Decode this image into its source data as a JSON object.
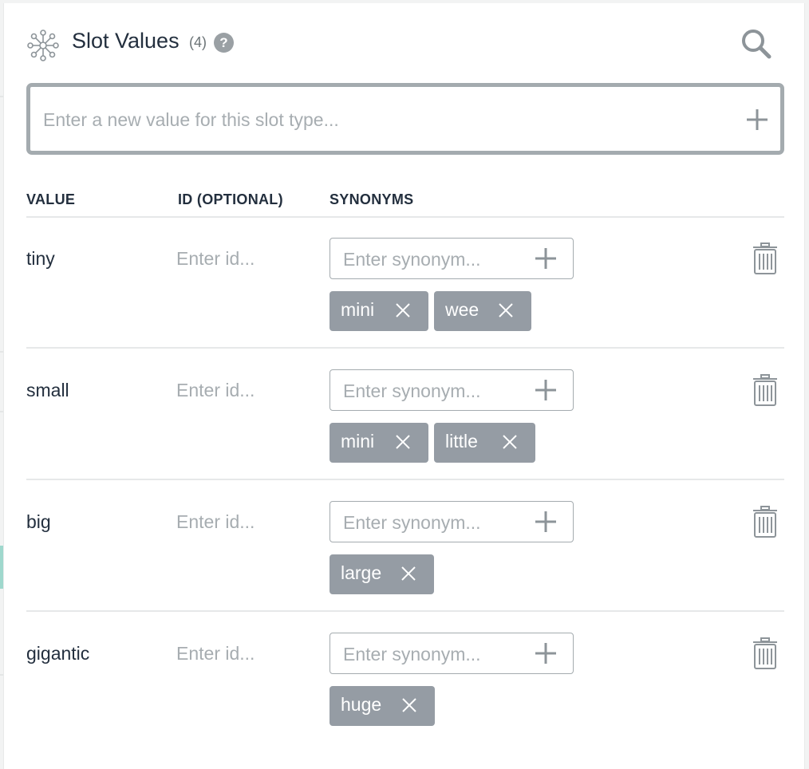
{
  "header": {
    "title": "Slot Values",
    "count": "(4)",
    "help_glyph": "?",
    "icons": {
      "slots": "slot-network-icon",
      "help": "question-circle-icon",
      "search": "search-icon"
    }
  },
  "new_value": {
    "placeholder": "Enter a new value for this slot type...",
    "value": ""
  },
  "columns": {
    "value": "VALUE",
    "id": "ID (OPTIONAL)",
    "synonyms": "SYNONYMS"
  },
  "rows": [
    {
      "value": "tiny",
      "id_placeholder": "Enter id...",
      "synonym_placeholder": "Enter synonym...",
      "synonyms": [
        "mini",
        "wee"
      ]
    },
    {
      "value": "small",
      "id_placeholder": "Enter id...",
      "synonym_placeholder": "Enter synonym...",
      "synonyms": [
        "mini",
        "little"
      ]
    },
    {
      "value": "big",
      "id_placeholder": "Enter id...",
      "synonym_placeholder": "Enter synonym...",
      "synonyms": [
        "large"
      ]
    },
    {
      "value": "gigantic",
      "id_placeholder": "Enter id...",
      "synonym_placeholder": "Enter synonym...",
      "synonyms": [
        "huge"
      ]
    }
  ],
  "colors": {
    "chip": "#959ca4",
    "border": "#a4abaf",
    "accent": "#9fd8cd",
    "text": "#232f3e"
  }
}
